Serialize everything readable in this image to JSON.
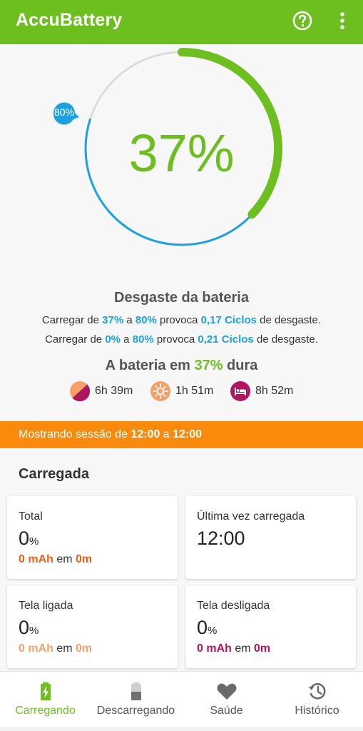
{
  "app": {
    "title": "AccuBattery"
  },
  "icons": {
    "help": "help-circle-icon",
    "more": "more-vert-icon"
  },
  "gauge": {
    "current_percent": 37,
    "current_label": "37%",
    "target_percent": 80,
    "target_label": "80%"
  },
  "wear": {
    "title": "Desgaste da bateria",
    "line1": {
      "prefix": "Carregar de ",
      "from": "37%",
      "middle": " a ",
      "to": "80%",
      "cause": " provoca ",
      "cycles": "0,17 Ciclos",
      "suffix": " de desgaste."
    },
    "line2": {
      "prefix": "Carregar de ",
      "from": "0%",
      "middle": " a ",
      "to": "80%",
      "cause": " provoca ",
      "cycles": "0,21 Ciclos",
      "suffix": " de desgaste."
    }
  },
  "lasts": {
    "prefix": "A bateria em ",
    "value": "37%",
    "suffix": " dura"
  },
  "durations": [
    {
      "icon": "mixed-usage-icon",
      "value": "6h 39m"
    },
    {
      "icon": "screen-on-sun-icon",
      "value": "1h 51m"
    },
    {
      "icon": "sleep-bed-icon",
      "value": "8h 52m"
    }
  ],
  "session": {
    "prefix": "Mostrando sessão de ",
    "start": "12:00",
    "middle": " a ",
    "end": "12:00"
  },
  "section": {
    "title": "Carregada"
  },
  "cards": [
    {
      "label": "Total",
      "value": "0",
      "unit": "%",
      "mah": "0 mAh",
      "em": " em ",
      "time": "0m",
      "color": "#e8601c"
    },
    {
      "label": "Última vez carregada",
      "value": "12:00"
    },
    {
      "label": "Tela ligada",
      "value": "0",
      "unit": "%",
      "mah": "0 mAh",
      "em": " em ",
      "time": "0m",
      "color": "#f4a06b"
    },
    {
      "label": "Tela desligada",
      "value": "0",
      "unit": "%",
      "mah": "0 mAh",
      "em": " em ",
      "time": "0m",
      "color": "#b0165f"
    }
  ],
  "nav": [
    {
      "label": "Carregando",
      "icon": "battery-charging-icon",
      "active": true
    },
    {
      "label": "Descarregando",
      "icon": "battery-discharging-icon",
      "active": false
    },
    {
      "label": "Saúde",
      "icon": "heart-icon",
      "active": false
    },
    {
      "label": "Histórico",
      "icon": "history-icon",
      "active": false
    }
  ],
  "colors": {
    "green": "#6cbf1e",
    "blue": "#1da1df",
    "orange": "#f98a0b",
    "orange_light": "#f4a06b",
    "magenta": "#b0165f"
  }
}
